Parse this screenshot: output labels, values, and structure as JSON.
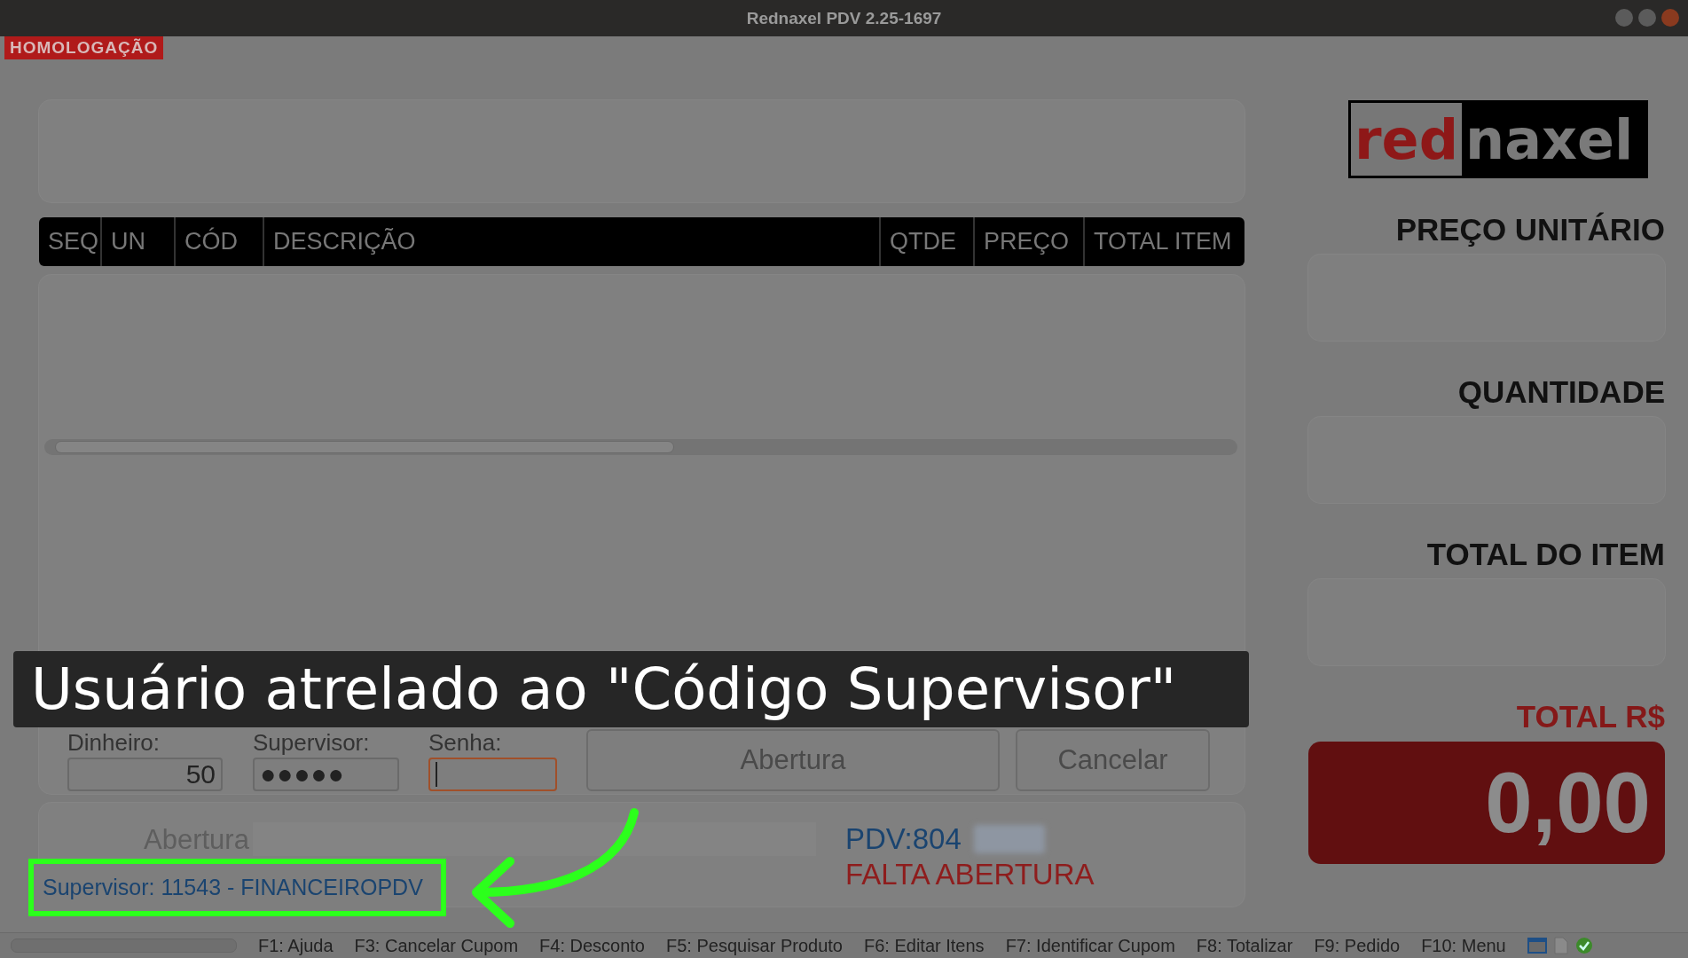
{
  "window": {
    "title": "Rednaxel PDV 2.25-1697"
  },
  "environment_badge": "HOMOLOGAÇÃO",
  "table": {
    "columns": [
      "SEQ",
      "UN",
      "CÓD",
      "DESCRIÇÃO",
      "QTDE",
      "PREÇO",
      "TOTAL ITEM"
    ]
  },
  "opening_form": {
    "fields": [
      {
        "kind": "text",
        "label": "Dinheiro:",
        "value": "50",
        "focused": false
      },
      {
        "kind": "password",
        "label": "Supervisor:",
        "value": "●●●●●",
        "focused": false
      },
      {
        "kind": "password",
        "label": "Senha:",
        "focused": true
      }
    ],
    "buttons": [
      "Abertura",
      "Cancelar"
    ]
  },
  "info": {
    "opening_label": "Abertura",
    "supervisor": "Supervisor: 11543 - FINANCEIROPDV",
    "pdv": "PDV:804",
    "status": "FALTA ABERTURA"
  },
  "side": {
    "logo": {
      "first": "red",
      "second": "naxel"
    },
    "fields": [
      {
        "label": "PREÇO UNITÁRIO"
      },
      {
        "label": "QUANTIDADE"
      },
      {
        "label": "TOTAL DO ITEM"
      }
    ],
    "total": {
      "label": "TOTAL R$",
      "value": "0,00"
    }
  },
  "shortcuts": [
    "F1: Ajuda",
    "F3: Cancelar Cupom",
    "F4: Desconto",
    "F5: Pesquisar Produto",
    "F6: Editar Itens",
    "F7: Identificar Cupom",
    "F8: Totalizar",
    "F9: Pedido",
    "F10: Menu"
  ],
  "caption": "Usuário atrelado ao \"Código Supervisor\""
}
